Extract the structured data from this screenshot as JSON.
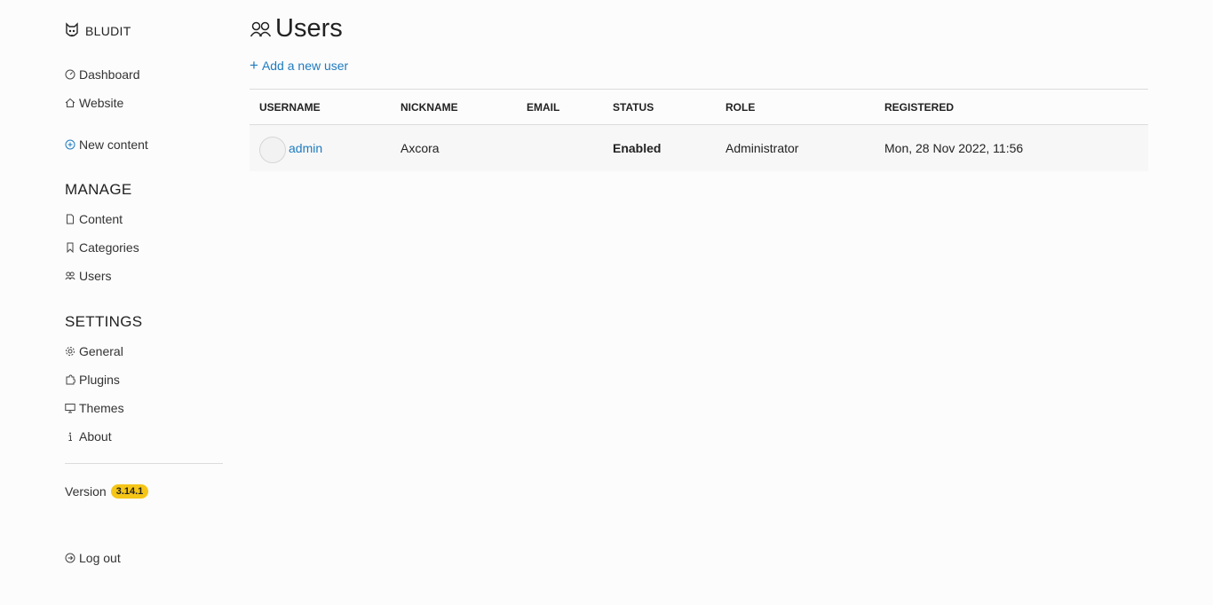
{
  "brand": {
    "name": "BLUDIT",
    "logo_icon": "bludit-logo-icon"
  },
  "nav": {
    "dashboard": {
      "label": "Dashboard",
      "icon": "dashboard-icon"
    },
    "website": {
      "label": "Website",
      "icon": "home-icon"
    },
    "new_content": {
      "label": "New content",
      "icon": "plus-circle-icon",
      "color": "#1e7bbf"
    }
  },
  "manage": {
    "heading": "MANAGE",
    "items": [
      {
        "label": "Content",
        "icon": "file-icon"
      },
      {
        "label": "Categories",
        "icon": "bookmark-icon"
      },
      {
        "label": "Users",
        "icon": "users-icon"
      }
    ]
  },
  "settings": {
    "heading": "SETTINGS",
    "items": [
      {
        "label": "General",
        "icon": "gear-icon"
      },
      {
        "label": "Plugins",
        "icon": "puzzle-icon"
      },
      {
        "label": "Themes",
        "icon": "monitor-icon"
      },
      {
        "label": "About",
        "icon": "info-icon"
      }
    ]
  },
  "version": {
    "label": "Version",
    "number": "3.14.1",
    "badge_color": "#f5c518"
  },
  "logout": {
    "label": "Log out",
    "icon": "logout-icon"
  },
  "page": {
    "title": "Users",
    "title_icon": "users-icon",
    "add_user": "Add a new user",
    "link_color": "#1e7bbf"
  },
  "table": {
    "headers": [
      "USERNAME",
      "NICKNAME",
      "EMAIL",
      "STATUS",
      "ROLE",
      "REGISTERED"
    ],
    "rows": [
      {
        "username": "admin",
        "nickname": "Axcora",
        "email": "",
        "status": "Enabled",
        "role": "Administrator",
        "registered": "Mon, 28 Nov 2022, 11:56"
      }
    ]
  }
}
